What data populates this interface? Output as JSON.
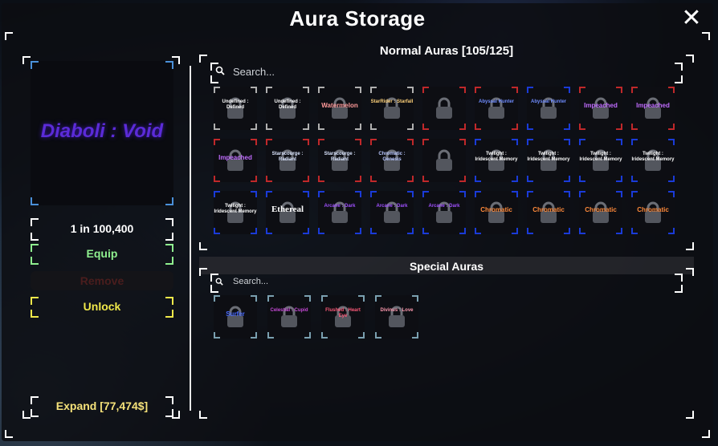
{
  "window": {
    "title": "Aura Storage",
    "close_label": "✕"
  },
  "selected": {
    "name": "Diaboli : Void",
    "rarity": "1 in 100,400",
    "equip_label": "Equip",
    "remove_label": "Remove",
    "unlock_label": "Unlock",
    "expand_label": "Expand [77,474$]"
  },
  "normal": {
    "title": "Normal Auras [105/125]",
    "search_placeholder": "Search...",
    "slots": [
      {
        "label": "Undefined : Defined",
        "color": "#ffffff",
        "border": "#b0b0b0"
      },
      {
        "label": "Undefined : Defined",
        "color": "#ffffff",
        "border": "#b0b0b0"
      },
      {
        "label": "Watermelon",
        "color": "#ff9a9a",
        "border": "#b0b0b0"
      },
      {
        "label": "StarRider : Starfall",
        "color": "#ffd27a",
        "border": "#b0b0b0"
      },
      {
        "label": "",
        "color": "#888888",
        "border": "#c0282a"
      },
      {
        "label": "Abyssal Hunter",
        "color": "#6f8cff",
        "border": "#c0282a"
      },
      {
        "label": "Abyssal Hunter",
        "color": "#6f8cff",
        "border": "#1a3bd8"
      },
      {
        "label": "Impeached",
        "color": "#c06cff",
        "border": "#c0282a"
      },
      {
        "label": "Impeached",
        "color": "#c06cff",
        "border": "#c0282a"
      },
      {
        "label": "Impeached",
        "color": "#c06cff",
        "border": "#c0282a"
      },
      {
        "label": "Starscourge : Radiant",
        "color": "#dbe6ff",
        "border": "#c0282a"
      },
      {
        "label": "Starscourge : Radiant",
        "color": "#dbe6ff",
        "border": "#c0282a"
      },
      {
        "label": "Chromatic : Genesis",
        "color": "#b8c7ff",
        "border": "#c0282a"
      },
      {
        "label": "",
        "color": "#6aa040",
        "border": "#c0282a"
      },
      {
        "label": "Twilight : Iridescent Memory",
        "color": "#ffffff",
        "border": "#1a3bd8"
      },
      {
        "label": "Twilight : Iridescent Memory",
        "color": "#ffffff",
        "border": "#1a3bd8"
      },
      {
        "label": "Twilight : Iridescent Memory",
        "color": "#ffffff",
        "border": "#1a3bd8"
      },
      {
        "label": "Twilight : Iridescent Memory",
        "color": "#ffffff",
        "border": "#1a3bd8"
      },
      {
        "label": "Twilight : Iridescent Memory",
        "color": "#ffffff",
        "border": "#1a3bd8"
      },
      {
        "label": "Ethereal",
        "color": "#ffffff",
        "border": "#1a3bd8"
      },
      {
        "label": "Arcane : Dark",
        "color": "#a050ff",
        "border": "#1a3bd8"
      },
      {
        "label": "Arcane : Dark",
        "color": "#a050ff",
        "border": "#1a3bd8"
      },
      {
        "label": "Arcane : Dark",
        "color": "#a050ff",
        "border": "#1a3bd8"
      },
      {
        "label": "Chromatic",
        "color": "#ff8a3a",
        "border": "#1a3bd8"
      },
      {
        "label": "Chromatic",
        "color": "#ff8a3a",
        "border": "#1a3bd8"
      },
      {
        "label": "Chromatic",
        "color": "#ff8a3a",
        "border": "#1a3bd8"
      },
      {
        "label": "Chromatic",
        "color": "#ff8a3a",
        "border": "#1a3bd8"
      }
    ]
  },
  "special": {
    "title": "Special Auras",
    "search_placeholder": "Search...",
    "slots": [
      {
        "label": "Surfer",
        "color": "#4a6cff",
        "border": "#7aa0b0"
      },
      {
        "label": "Celestial : Cupid",
        "color": "#c84ad8",
        "border": "#7aa0b0"
      },
      {
        "label": "Flushed : Heart Eye",
        "color": "#ff5a7a",
        "border": "#7aa0b0"
      },
      {
        "label": "Divinus : Love",
        "color": "#ff9ab0",
        "border": "#7aa0b0"
      }
    ]
  }
}
